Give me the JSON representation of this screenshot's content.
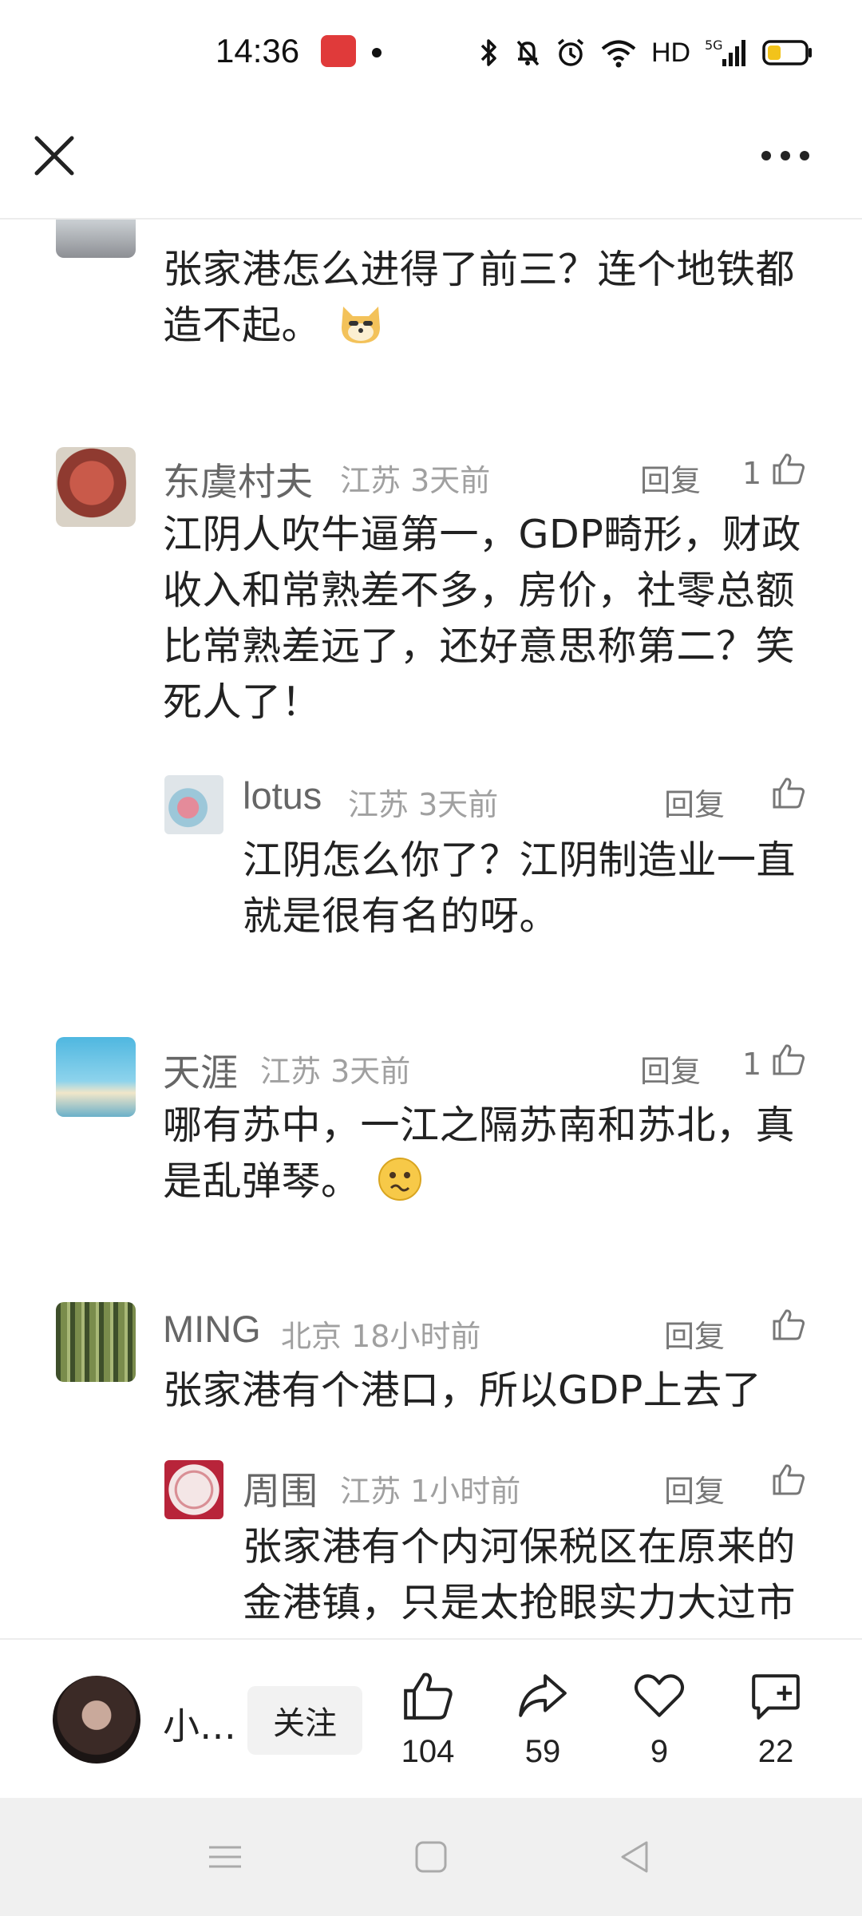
{
  "status_bar": {
    "time": "14:36",
    "icons": [
      "shopping-618-icon",
      "dot",
      "bluetooth-icon",
      "mute-icon",
      "alarm-icon",
      "wifi-icon",
      "HD",
      "5g-signal-icon",
      "battery-icon"
    ],
    "hd_label": "HD",
    "network_label": "5G"
  },
  "top_nav": {
    "close_icon": "close-icon",
    "more_icon": "more-icon"
  },
  "comments": [
    {
      "name": "",
      "meta": "",
      "text": "张家港怎么进得了前三？连个地铁都造不起。",
      "has_emoji": true
    },
    {
      "name": "东虞村夫",
      "meta": "江苏 3天前",
      "reply_label": "回复",
      "like_count": "1",
      "text": "江阴人吹牛逼第一，GDP畸形，财政收入和常熟差不多，房价，社零总额比常熟差远了，还好意思称第二？笑死人了！",
      "replies": [
        {
          "name": "lotus",
          "meta": "江苏 3天前",
          "reply_label": "回复",
          "text": "江阴怎么你了？江阴制造业一直就是很有名的呀。"
        }
      ]
    },
    {
      "name": "天涯",
      "meta": "江苏 3天前",
      "reply_label": "回复",
      "like_count": "1",
      "text": "哪有苏中，一江之隔苏南和苏北，真是乱弹琴。"
    },
    {
      "name": "MING",
      "meta": "北京 18小时前",
      "reply_label": "回复",
      "text": "张家港有个港口，所以GDP上去了",
      "replies": [
        {
          "name": "周围",
          "meta": "江苏 1小时前",
          "reply_label": "回复",
          "text": "张家港有个内河保税区在原来的金港镇，只是太抢眼实力大过市"
        }
      ]
    }
  ],
  "action_bar": {
    "author_name": "小…",
    "follow_label": "关注",
    "like_count": "104",
    "share_count": "59",
    "favorite_count": "9",
    "comment_count": "22"
  },
  "colors": {
    "text_primary": "#222222",
    "text_name": "#666666",
    "text_meta": "#a0a0a0",
    "follow_bg": "#f2f2f2",
    "sys_nav_bg": "#f0f0f0"
  }
}
